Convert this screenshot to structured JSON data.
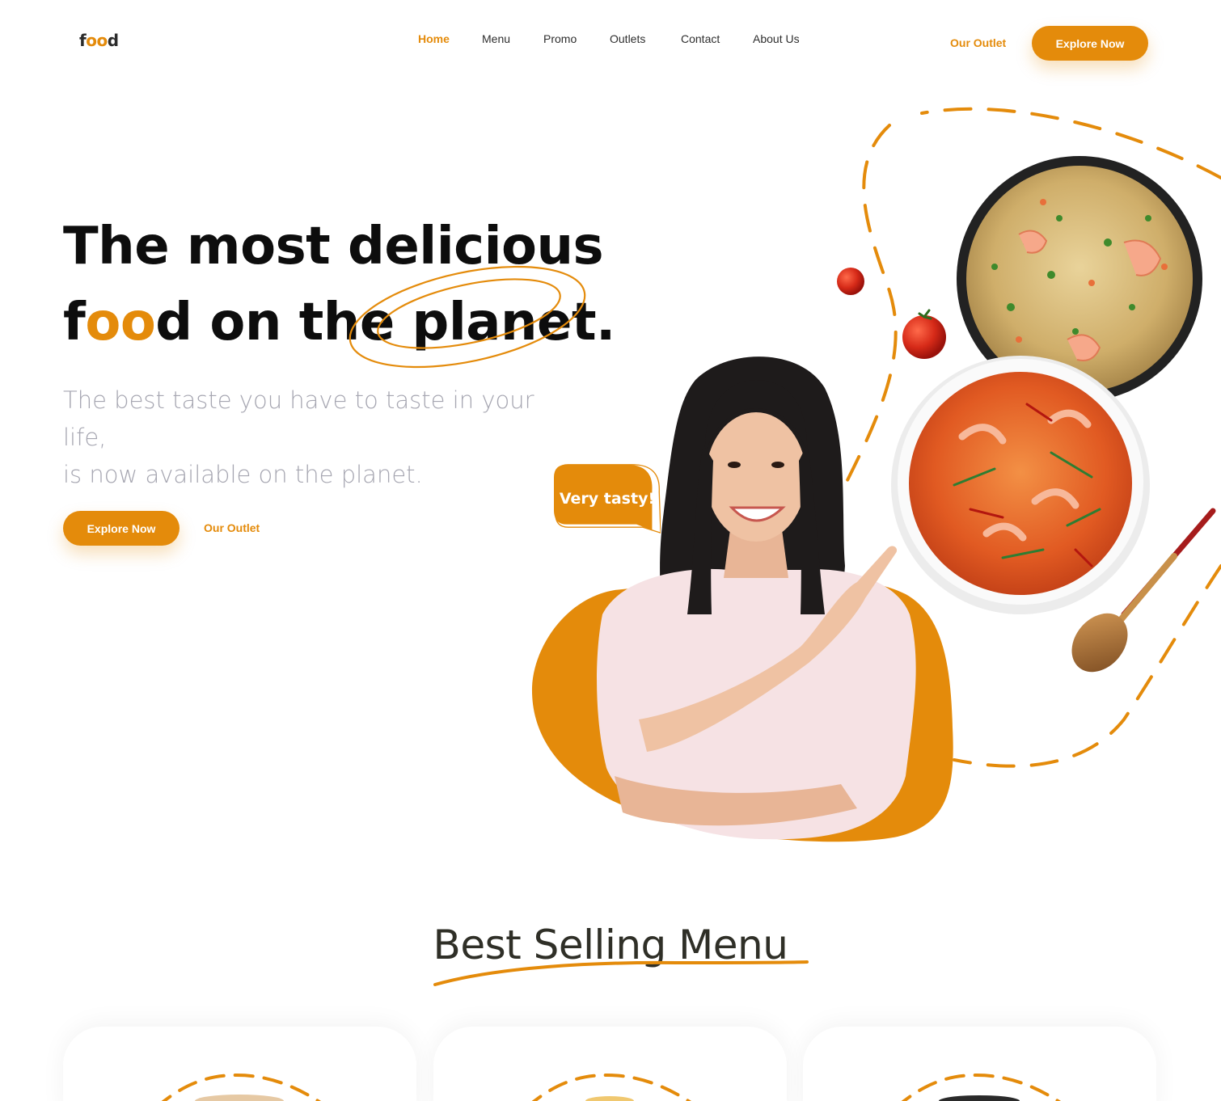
{
  "brand": {
    "logo_f": "f",
    "logo_oo": "oo",
    "logo_d": "d",
    "accent_color": "#e48b0b"
  },
  "nav": {
    "items": [
      {
        "label": "Home",
        "active": true
      },
      {
        "label": "Menu",
        "active": false
      },
      {
        "label": "Promo",
        "active": false
      },
      {
        "label": "Outlets",
        "active": false
      },
      {
        "label": "Contact",
        "active": false
      },
      {
        "label": "About Us",
        "active": false
      }
    ],
    "outlet_link": "Our Outlet",
    "explore_button": "Explore Now"
  },
  "hero": {
    "headline_line1": "The most delicious",
    "headline_f": "f",
    "headline_oo": "oo",
    "headline_rest": "d on the planet.",
    "subtitle_line1": "The best taste you have to taste in your life,",
    "subtitle_line2": "is now available on the planet.",
    "explore_button": "Explore Now",
    "outlet_link": "Our Outlet",
    "speech_bubble": "Very tasty!"
  },
  "best_selling": {
    "title": "Best Selling Menu",
    "cards": [
      {},
      {},
      {}
    ]
  }
}
